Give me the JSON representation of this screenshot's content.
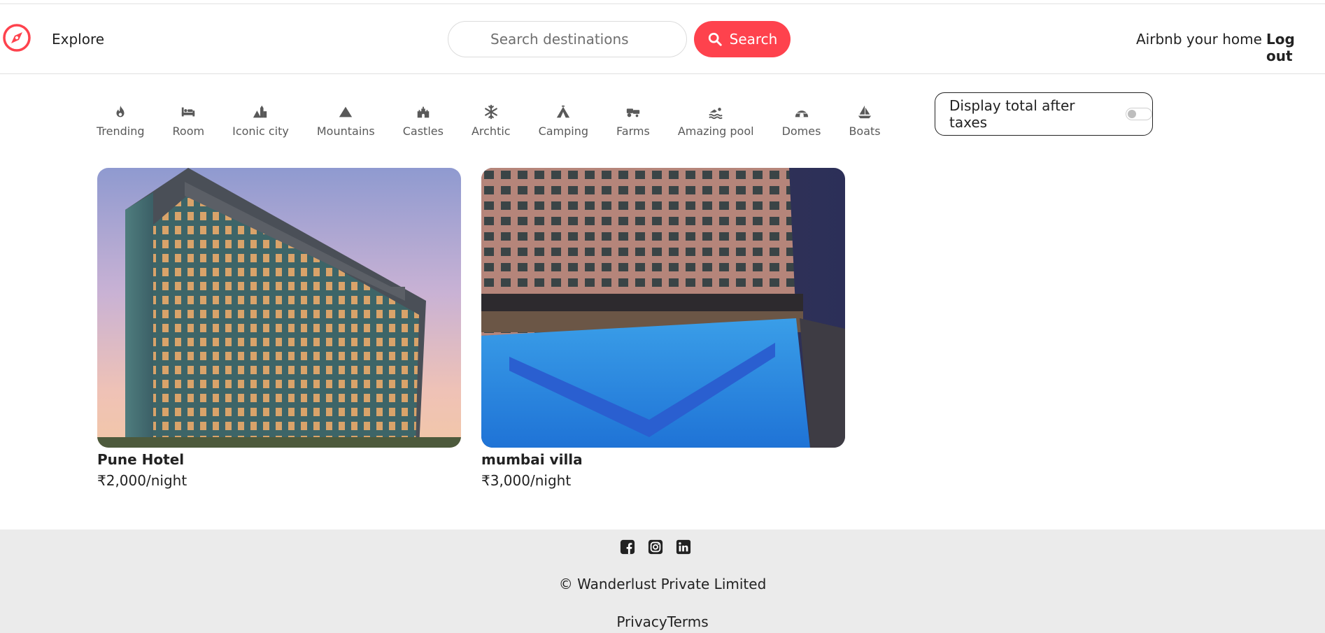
{
  "navbar": {
    "explore_label": "Explore",
    "search_placeholder": "Search destinations",
    "search_button_label": "Search",
    "host_label": "Airbnb your home",
    "logout_label": "Log out",
    "brand_color": "#fe424d"
  },
  "filters": [
    {
      "label": "Trending",
      "icon": "fire-icon"
    },
    {
      "label": "Room",
      "icon": "bed-icon"
    },
    {
      "label": "Iconic city",
      "icon": "city-icon"
    },
    {
      "label": "Mountains",
      "icon": "mountain-icon"
    },
    {
      "label": "Castles",
      "icon": "castle-icon"
    },
    {
      "label": "Archtic",
      "icon": "snowflake-icon"
    },
    {
      "label": "Camping",
      "icon": "tent-icon"
    },
    {
      "label": "Farms",
      "icon": "tractor-icon"
    },
    {
      "label": "Amazing pool",
      "icon": "swimmer-icon"
    },
    {
      "label": "Domes",
      "icon": "igloo-icon"
    },
    {
      "label": "Boats",
      "icon": "sailboat-icon"
    }
  ],
  "tax_toggle": {
    "label": "Display total after taxes",
    "enabled": false
  },
  "listings": [
    {
      "title": "Pune Hotel",
      "price": "₹2,000/night",
      "image": "hotel-tower-photo"
    },
    {
      "title": "mumbai villa",
      "price": "₹3,000/night",
      "image": "hotel-pool-night-photo"
    }
  ],
  "footer": {
    "social_icons": [
      "facebook-icon",
      "instagram-icon",
      "linkedin-icon"
    ],
    "copyright": "© Wanderlust Private Limited",
    "privacy_label": "Privacy",
    "terms_label": "Terms",
    "background": "#ebebeb"
  }
}
